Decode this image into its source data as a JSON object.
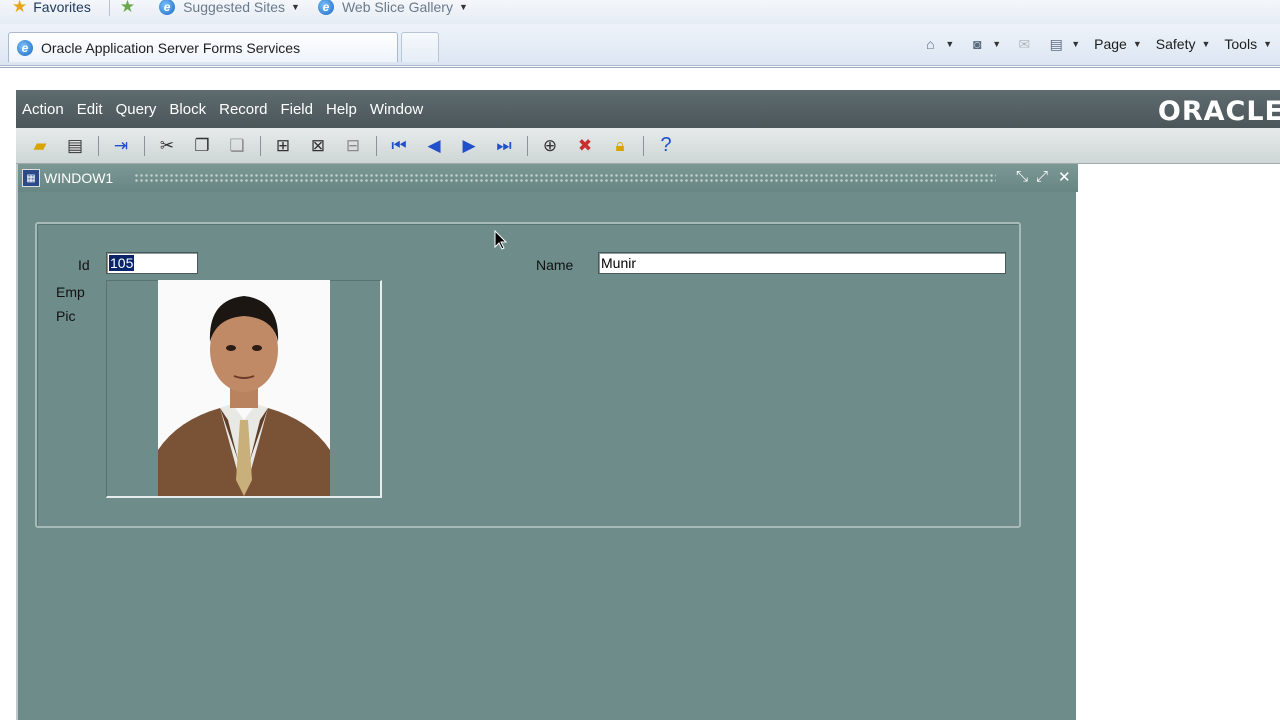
{
  "browser": {
    "favorites_bar": {
      "favorites_label": "Favorites",
      "suggested_sites_label": "Suggested Sites",
      "web_slice_gallery_label": "Web Slice Gallery"
    },
    "tab_title": "Oracle Application Server Forms Services",
    "command_bar": {
      "page_label": "Page",
      "safety_label": "Safety",
      "tools_label": "Tools"
    }
  },
  "forms": {
    "menu": [
      "Action",
      "Edit",
      "Query",
      "Block",
      "Record",
      "Field",
      "Help",
      "Window"
    ],
    "brand": "ORACLE",
    "window_title": "WINDOW1",
    "fields": {
      "id_label": "Id",
      "id_value": "105",
      "name_label": "Name",
      "name_value": "Munir",
      "emp_pic_label_line1": "Emp",
      "emp_pic_label_line2": "Pic"
    }
  },
  "icons": {
    "toolbar": [
      "save-icon",
      "print-icon",
      "exit-icon",
      "cut-icon",
      "copy-icon",
      "paste-icon",
      "enter-query-icon",
      "execute-query-icon",
      "cancel-query-icon",
      "previous-block-icon",
      "previous-record-icon",
      "next-record-icon",
      "next-block-icon",
      "insert-record-icon",
      "delete-record-icon",
      "lock-record-icon",
      "help-icon"
    ]
  },
  "colors": {
    "menubar": "#4b5659",
    "canvas": "#6e8c8a",
    "selection": "#0a246a"
  }
}
